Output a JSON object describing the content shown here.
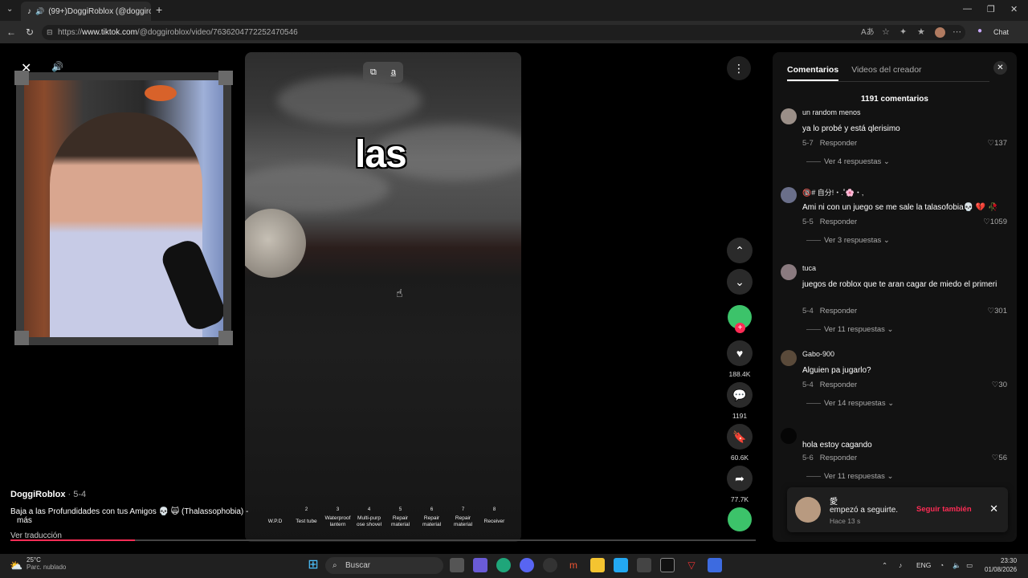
{
  "browser": {
    "tab_title": "(99+)DoggiRoblox (@doggiro",
    "url_prefix": "https://",
    "url_domain": "www.tiktok.com",
    "url_path": "/@doggiroblox/video/7636204772252470546",
    "chat_label": "Chat"
  },
  "video": {
    "caption_word": "las",
    "hotbar": [
      {
        "n": "",
        "label": "W.P.D"
      },
      {
        "n": "2",
        "label": "Test tube"
      },
      {
        "n": "3",
        "label": "Waterproof lantern"
      },
      {
        "n": "4",
        "label": "Multi-purp ose shovel"
      },
      {
        "n": "5",
        "label": "Repair material"
      },
      {
        "n": "6",
        "label": "Repair material"
      },
      {
        "n": "7",
        "label": "Repair material"
      },
      {
        "n": "8",
        "label": "Receiver"
      }
    ],
    "progress_fraction": 0.167
  },
  "post": {
    "author": "DoggiRoblox",
    "date": " · 5-4",
    "description": "Baja a las Profundidades con tus Amigos 💀 🙀 (Thalassophobia) -",
    "more": "más",
    "translate": "Ver traducción"
  },
  "rail": {
    "likes": "188.4K",
    "comments": "1191",
    "saves": "60.6K",
    "shares": "77.7K"
  },
  "panel": {
    "tab_comments": "Comentarios",
    "tab_creator": "Videos del creador",
    "count": "1191 comentarios",
    "reply_label": "Responder",
    "comments": [
      {
        "name": "un random menos",
        "text": "ya lo probé y está qlerisimo",
        "date": "5-7",
        "likes": "137",
        "more": "Ver 4 respuestas ⌄"
      },
      {
        "name": "🔞# 自分!・.˚🌸・,",
        "text": "Ami ni con un juego se me sale la talasofobia💀 💔 🥀",
        "date": "5-5",
        "likes": "1059",
        "more": "Ver 3 respuestas ⌄"
      },
      {
        "name": "tuca",
        "text": "juegos de roblox que te aran cagar de miedo el primeri",
        "date": "5-4",
        "likes": "301",
        "more": "Ver 11 respuestas ⌄"
      },
      {
        "name": "Gabo-900",
        "text": "Alguien pa jugarlo?",
        "date": "5-4",
        "likes": "30",
        "more": "Ver 14 respuestas ⌄"
      },
      {
        "name": "",
        "text": "hola estoy cagando",
        "date": "5-6",
        "likes": "56",
        "more": "Ver 11 respuestas ⌄"
      }
    ]
  },
  "toast": {
    "name": "愛",
    "text": "empezó a seguirte.",
    "time": "Hace 13 s",
    "follow": "Seguir también"
  },
  "taskbar": {
    "temp": "25°C",
    "weather": "Parc. nublado",
    "search": "Buscar",
    "lang": "ENG",
    "time": "23:30",
    "date": "01/08/2026"
  },
  "colors": {
    "accent": "#fe2c55",
    "panel_bg": "#121212"
  }
}
